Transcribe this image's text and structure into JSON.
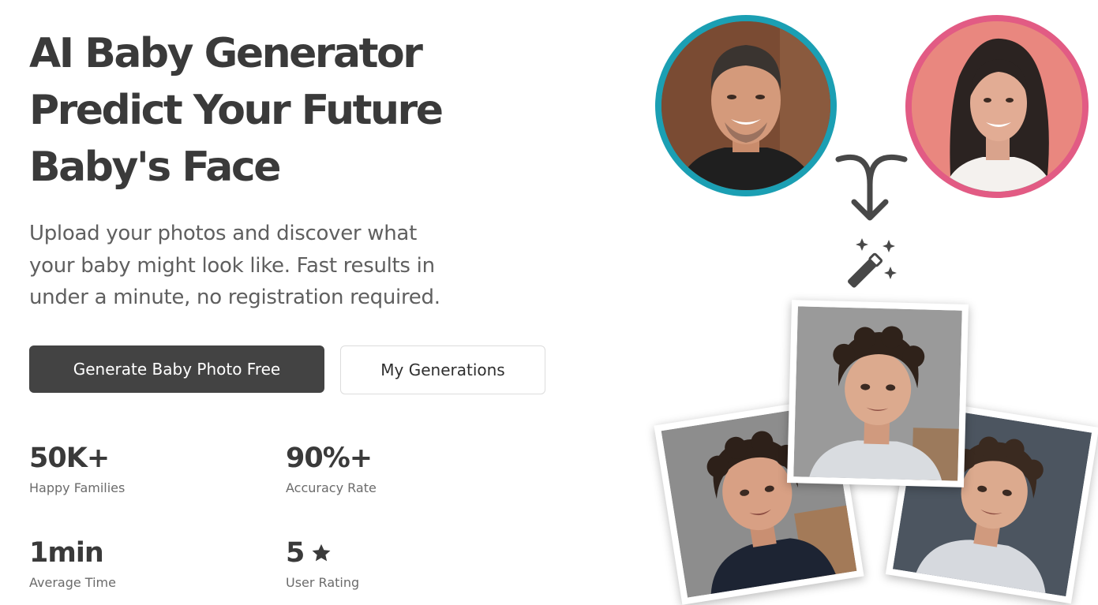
{
  "hero": {
    "title_lines": [
      "AI Baby Generator",
      "Predict Your Future",
      "Baby's Face"
    ],
    "subtitle_lines": [
      "Upload your photos and discover what",
      "your baby might look like. Fast results in",
      "under a minute, no registration required."
    ]
  },
  "actions": {
    "primary_label": "Generate Baby Photo Free",
    "secondary_label": "My Generations"
  },
  "stats": [
    {
      "value": "50K+",
      "label": "Happy Families"
    },
    {
      "value": "90%+",
      "label": "Accuracy Rate"
    },
    {
      "value": "1min",
      "label": "Average Time"
    },
    {
      "value": "5",
      "label": "User Rating",
      "icon": "star-icon"
    }
  ],
  "illustration": {
    "parent_1": {
      "image": "father-photo",
      "ring_color": "#1b9fb3"
    },
    "parent_2": {
      "image": "mother-photo",
      "ring_color": "#e25b84"
    },
    "merge_icon": "merge-arrow-icon",
    "magic_icon": "magic-wand-icon",
    "results": [
      "baby-photo-left",
      "baby-photo-center",
      "baby-photo-right"
    ]
  },
  "colors": {
    "primary_button": "#434343",
    "heading_text": "#3a3a3a",
    "body_text": "#5f5f5f"
  }
}
